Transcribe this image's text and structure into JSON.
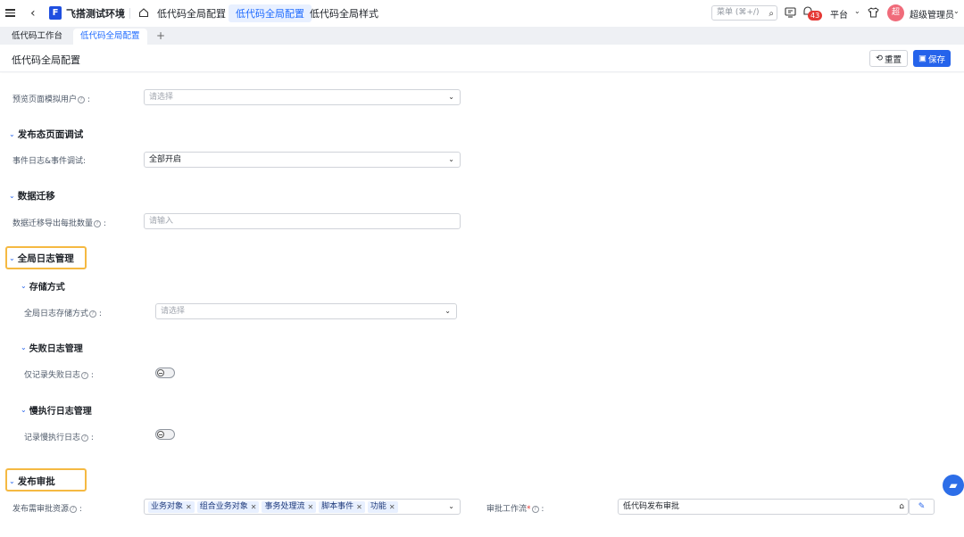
{
  "topbar": {
    "app_title": "飞搭测试环境",
    "crumbs": [
      "低代码全局配置",
      "低代码全局配置",
      "低代码全局样式"
    ],
    "search_placeholder": "菜单 (⌘+/)",
    "badge_count": "43",
    "platform": "平台",
    "avatar_text": "超",
    "username": "超级管理员"
  },
  "tabs": [
    "低代码工作台",
    "低代码全局配置"
  ],
  "tab_add": "+",
  "page": {
    "title": "低代码全局配置",
    "reset_label": "重置",
    "save_label": "保存"
  },
  "form": {
    "preview_user": {
      "label": "预览页面模拟用户",
      "placeholder": "请选择"
    },
    "publish_debug": {
      "title": "发布态页面调试",
      "field_label": "事件日志&事件调试:",
      "value": "全部开启"
    },
    "migration": {
      "title": "数据迁移",
      "field_label": "数据迁移导出每批数量",
      "placeholder": "请输入"
    },
    "global_log": {
      "title": "全局日志管理",
      "storage": {
        "title": "存储方式",
        "field_label": "全局日志存储方式",
        "placeholder": "请选择"
      },
      "failure": {
        "title": "失败日志管理",
        "field_label": "仅记录失败日志"
      },
      "slow": {
        "title": "慢执行日志管理",
        "field_label": "记录慢执行日志"
      }
    },
    "publish_review": {
      "title": "发布审批",
      "resource_label": "发布需审批资源",
      "resource_chips": [
        "业务对象",
        "组合业务对象",
        "事务处理流",
        "脚本事件",
        "功能"
      ],
      "workflow_label": "审批工作流",
      "workflow_value": "低代码发布审批"
    }
  }
}
